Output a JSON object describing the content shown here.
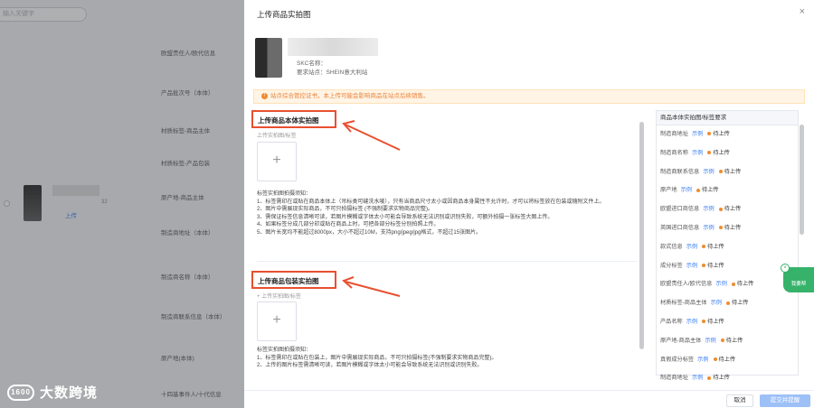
{
  "background": {
    "search_placeholder": "输入关键字",
    "labels": [
      "欧盟责任人/欧代信息",
      "产品批次号（本体）",
      "材质标签-商品主体",
      "材质标签-产品包装",
      "原产地-商品主体",
      "制造商地址（本体）",
      "制造商名称（本体）",
      "制造商联系信息（本体）",
      "原产地(本体)",
      "十四基事件人/十代信息"
    ],
    "row_count": "32",
    "upload_link": "上传",
    "logo_text": "大数跨境",
    "logo_mark": "1600"
  },
  "drawer": {
    "title": "上传商品实拍图",
    "close": "×",
    "product": {
      "skc_label": "SKC名称：",
      "site_label": "要求站点：",
      "site_value": "SHEIN意大利站"
    },
    "warning": "站点综合管控证书，本上传可能会影响商品在站点后续销售。",
    "section1": {
      "title": "上传商品本体实拍图",
      "subtitle": "上传实拍图/标签",
      "rules_title": "标签实拍图拍摄须知：",
      "rules": [
        "1、标签需印在或贴在商品本体上（吊标类可缝洗水唛），只有当商品尺寸太小或因商品本身属性不允许时，才可以将标签放在包装或随附文件上。",
        "2、图片中需展现实际商品，不可只拍摄标签 (不强制要求实物商品完整)。",
        "3、需保证标签信息清晰可读，若图片模糊或字体太小可能会导致系统无法识别或识别失败，可额外拍摄一张标签大图上传。",
        "4、如果标签分成几部分印或贴在商品上时，可把各部分标签分别拍照上传。",
        "5、图片长宽均不能超过8000px，大小不超过10M，支持png/jpeg/jpg格式，不超过15张图片。"
      ]
    },
    "section2": {
      "title": "上传商品包装实拍图",
      "subtitle": "+ 上传实拍图/标签",
      "rules_title": "标签实拍图拍摄须知：",
      "rules": [
        "1、标签需印在或贴在包装上，图片中需展现实际商品，不可只拍摄标签(不强制要求实物商品完整)。",
        "2、上传的图片标签需清晰可读，若图片模糊或字体太小可能会导致系统无法识别或识别失败。"
      ]
    },
    "upload_plus": "+",
    "right_panel": {
      "header": "商品本体实拍图/标签要求",
      "example": "示例",
      "status": "待上传",
      "items": [
        "制造商地址",
        "制造商名称",
        "制造商联系信息",
        "原产地",
        "欧盟进口商信息",
        "英国进口商信息",
        "款式信息",
        "成分标签",
        "欧盟责任人/欧代信息",
        "材质标签-商品主体",
        "产品名称",
        "原产地-商品主体",
        "真假成分标签",
        "制造商地址"
      ]
    },
    "float_button": "我要帮",
    "float_close": "×",
    "footer": {
      "cancel": "取消",
      "submit": "提交并提醒"
    }
  },
  "colors": {
    "accent_red": "#e8502f",
    "primary_blue": "#3b7df2",
    "warning_orange": "#f08c2e",
    "success_green": "#37b26b"
  }
}
